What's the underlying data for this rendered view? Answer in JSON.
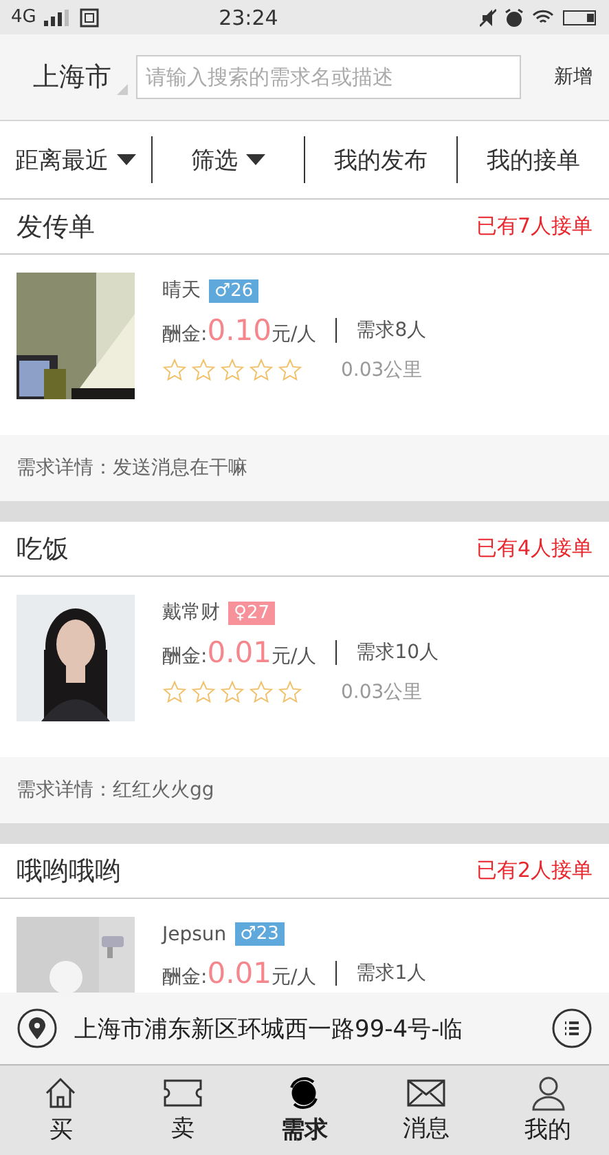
{
  "status_bar": {
    "network": "4G",
    "time": "23:24"
  },
  "header": {
    "city": "上海市",
    "search": {
      "placeholder": "请输入搜索的需求名或描述"
    },
    "add": "新增"
  },
  "filters": [
    {
      "label": "距离最近",
      "dropdown": true
    },
    {
      "label": "筛选",
      "dropdown": true
    },
    {
      "label": "我的发布",
      "dropdown": false
    },
    {
      "label": "我的接单",
      "dropdown": false
    }
  ],
  "posts": [
    {
      "title": "发传单",
      "taken": "已有7人接单",
      "name": "晴天",
      "color": "#5fa8dc",
      "badge": "♂26",
      "reward_label": "酬金:",
      "reward": "0.10",
      "unit": "元/人",
      "need": "需求8人",
      "stars": 0,
      "distance": "0.03公里",
      "details": "需求详情：发送消息在干嘛",
      "kind": "picture"
    },
    {
      "title": "吃饭",
      "taken": "已有4人接单",
      "name": "戴常财",
      "color": "#f7919a",
      "badge": "♀27",
      "reward_label": "酬金:",
      "reward": "0.01",
      "unit": "元/人",
      "need": "需求10人",
      "stars": 0,
      "distance": "0.03公里",
      "details": "需求详情：红红火火gg",
      "kind": "picture"
    },
    {
      "title": "哦哟哦哟",
      "taken": "已有2人接单",
      "name": "Jepsun",
      "color": "#5fa8dc",
      "badge": "♂23",
      "reward_label": "酬金:",
      "reward": "0.01",
      "unit": "元/人",
      "need": "需求1人",
      "kind": "picture"
    }
  ],
  "location": {
    "address": "上海市浦东新区环城西一路99-4号-临"
  },
  "tabs": [
    {
      "label": "买",
      "selected": false
    },
    {
      "label": "卖",
      "selected": false
    },
    {
      "label": "需求",
      "selected": true
    },
    {
      "label": "消息",
      "selected": false
    },
    {
      "label": "我的",
      "selected": false
    }
  ]
}
